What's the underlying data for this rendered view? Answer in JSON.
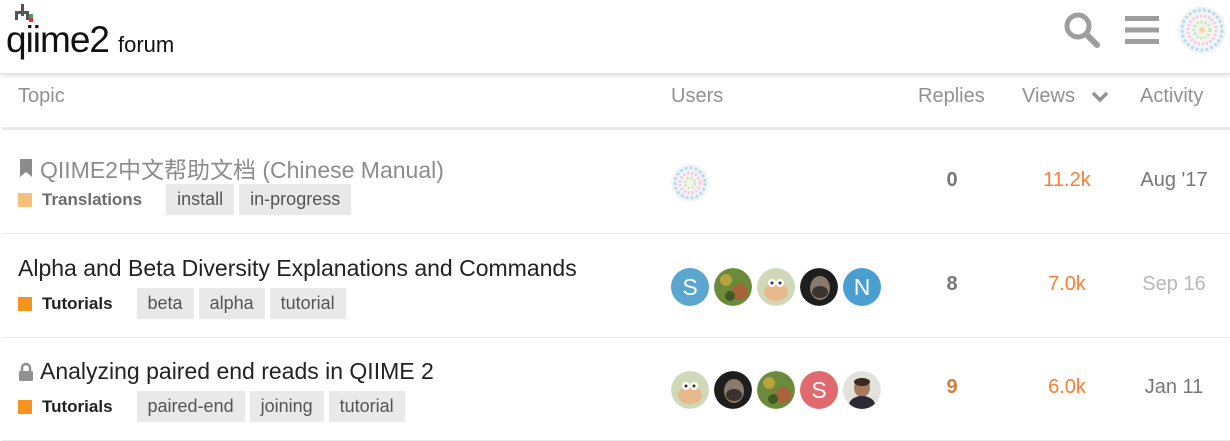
{
  "header": {
    "logo_main": "qiime2",
    "logo_sub": "forum",
    "search_icon": "search-icon",
    "menu_icon": "hamburger-menu-icon",
    "avatar_icon": "user-avatar"
  },
  "columns": {
    "topic": "Topic",
    "users": "Users",
    "replies": "Replies",
    "views": "Views",
    "activity": "Activity"
  },
  "topics": [
    {
      "title": "QIIME2中文帮助文档 (Chinese Manual)",
      "status_icon": "bookmark-icon",
      "category": "Translations",
      "category_color": "#f7c07a",
      "tags": [
        "install",
        "in-progress"
      ],
      "replies": "0",
      "views": "11.2k",
      "activity": "Aug '17"
    },
    {
      "title": "Alpha and Beta Diversity Explanations and Commands",
      "category": "Tutorials",
      "category_color": "#f7941d",
      "tags": [
        "beta",
        "alpha",
        "tutorial"
      ],
      "users_letters": [
        "S",
        "N"
      ],
      "replies": "8",
      "views": "7.0k",
      "activity": "Sep 16"
    },
    {
      "title": "Analyzing paired end reads in QIIME 2",
      "status_icon": "lock-icon",
      "category": "Tutorials",
      "category_color": "#f7941d",
      "tags": [
        "paired-end",
        "joining",
        "tutorial"
      ],
      "users_letters": [
        "S"
      ],
      "replies": "9",
      "views": "6.0k",
      "activity": "Jan 11"
    }
  ],
  "colors": {
    "views": "#fb7d31",
    "avatar_s_blue": "#5aa6cf",
    "avatar_n_blue": "#4a9fd1",
    "avatar_s_red": "#e06a70"
  }
}
